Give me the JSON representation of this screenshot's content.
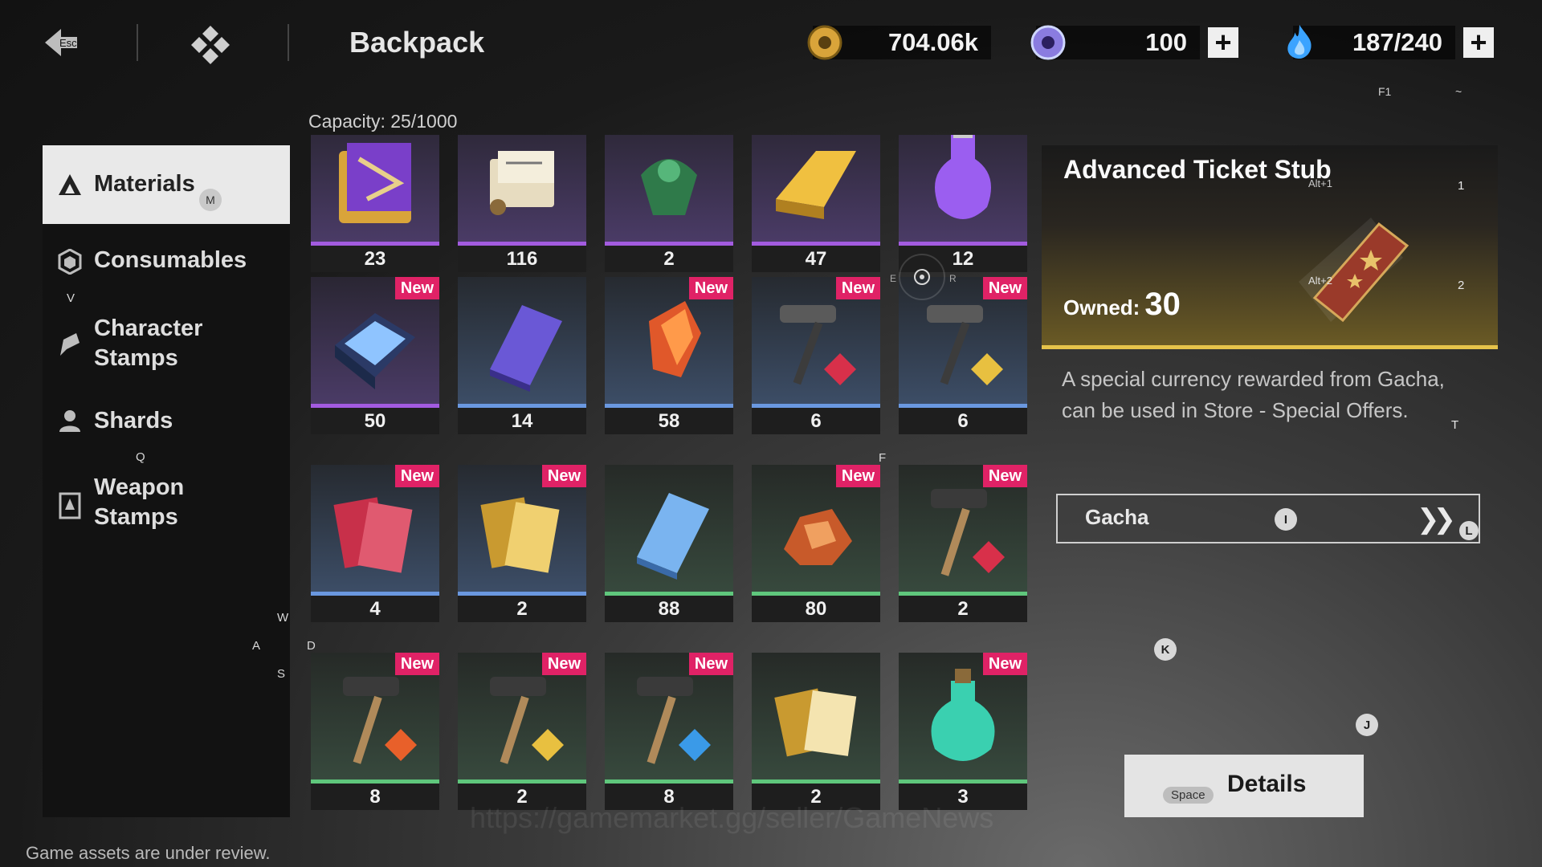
{
  "header": {
    "back_key": "Esc",
    "title": "Backpack",
    "gold": "704.06k",
    "premium": "100",
    "stamina": "187/240",
    "key_f1": "F1",
    "key_tilde": "~",
    "colors": {
      "gold": "#d9a43a",
      "premium": "#8a7ce0",
      "stamina": "#3aa3ff"
    }
  },
  "sidebar": {
    "items": [
      {
        "label": "Materials",
        "icon": "materials-icon",
        "key": "M",
        "active": true
      },
      {
        "label": "Consumables",
        "icon": "consumables-icon",
        "key": "V"
      },
      {
        "label": "Character\nStamps",
        "icon": "character-stamps-icon"
      },
      {
        "label": "Shards",
        "icon": "shards-icon",
        "key": "Q"
      },
      {
        "label": "Weapon\nStamps",
        "icon": "weapon-stamps-icon"
      }
    ]
  },
  "inventory": {
    "capacity": "Capacity: 25/1000",
    "new_label": "New",
    "items": [
      {
        "count": "23",
        "rarity": "purple",
        "icon": "tome-icon",
        "new": false
      },
      {
        "count": "116",
        "rarity": "purple",
        "icon": "scroll-icon",
        "new": false
      },
      {
        "count": "2",
        "rarity": "purple",
        "icon": "jade-pendant-icon",
        "new": false
      },
      {
        "count": "47",
        "rarity": "purple",
        "icon": "gold-ingot-icon",
        "new": false
      },
      {
        "count": "12",
        "rarity": "purple",
        "icon": "purple-potion-icon",
        "new": false
      },
      {
        "count": "50",
        "rarity": "purple",
        "icon": "crystal-box-icon",
        "new": true
      },
      {
        "count": "14",
        "rarity": "blue",
        "icon": "purple-book-icon",
        "new": false
      },
      {
        "count": "58",
        "rarity": "blue",
        "icon": "fire-crystal-icon",
        "new": true
      },
      {
        "count": "6",
        "rarity": "blue",
        "icon": "forge-hammer-red-icon",
        "new": true
      },
      {
        "count": "6",
        "rarity": "blue",
        "icon": "forge-hammer-gold-icon",
        "new": true
      },
      {
        "count": "4",
        "rarity": "blue",
        "icon": "red-scrolls-icon",
        "new": true
      },
      {
        "count": "2",
        "rarity": "blue",
        "icon": "gold-scrolls-icon",
        "new": true
      },
      {
        "count": "88",
        "rarity": "green",
        "icon": "blue-book-icon",
        "new": false
      },
      {
        "count": "80",
        "rarity": "green",
        "icon": "ore-icon",
        "new": true
      },
      {
        "count": "2",
        "rarity": "green",
        "icon": "hammer-red-icon",
        "new": true
      },
      {
        "count": "8",
        "rarity": "green",
        "icon": "hammer-orange-icon",
        "new": true
      },
      {
        "count": "2",
        "rarity": "green",
        "icon": "hammer-yellow-icon",
        "new": true
      },
      {
        "count": "8",
        "rarity": "green",
        "icon": "hammer-blue-icon",
        "new": true
      },
      {
        "count": "2",
        "rarity": "green",
        "icon": "gold-cards-icon",
        "new": false
      },
      {
        "count": "3",
        "rarity": "green",
        "icon": "green-potion-icon",
        "new": true
      }
    ]
  },
  "detail": {
    "title": "Advanced Ticket Stub",
    "owned_label": "Owned:",
    "owned_value": "30",
    "alt1": "Alt+1",
    "alt2": "Alt+2",
    "key1": "1",
    "key2": "2",
    "key_t": "T",
    "description": "A special currency rewarded from Gacha, can be used in Store - Special Offers.",
    "source_label": "Gacha",
    "source_key_i": "I",
    "source_key_l": "L",
    "key_k": "K",
    "key_j": "J",
    "details_label": "Details",
    "details_key": "Space",
    "accent": "#e6c34a"
  },
  "misc": {
    "footer": "Game assets are under review.",
    "watermark": "https://gamemarket.gg/seller/GameNews",
    "wasd": {
      "w": "W",
      "a": "A",
      "s": "S",
      "d": "D"
    },
    "crosshair": {
      "e": "E",
      "r": "R"
    },
    "key_f": "F"
  }
}
